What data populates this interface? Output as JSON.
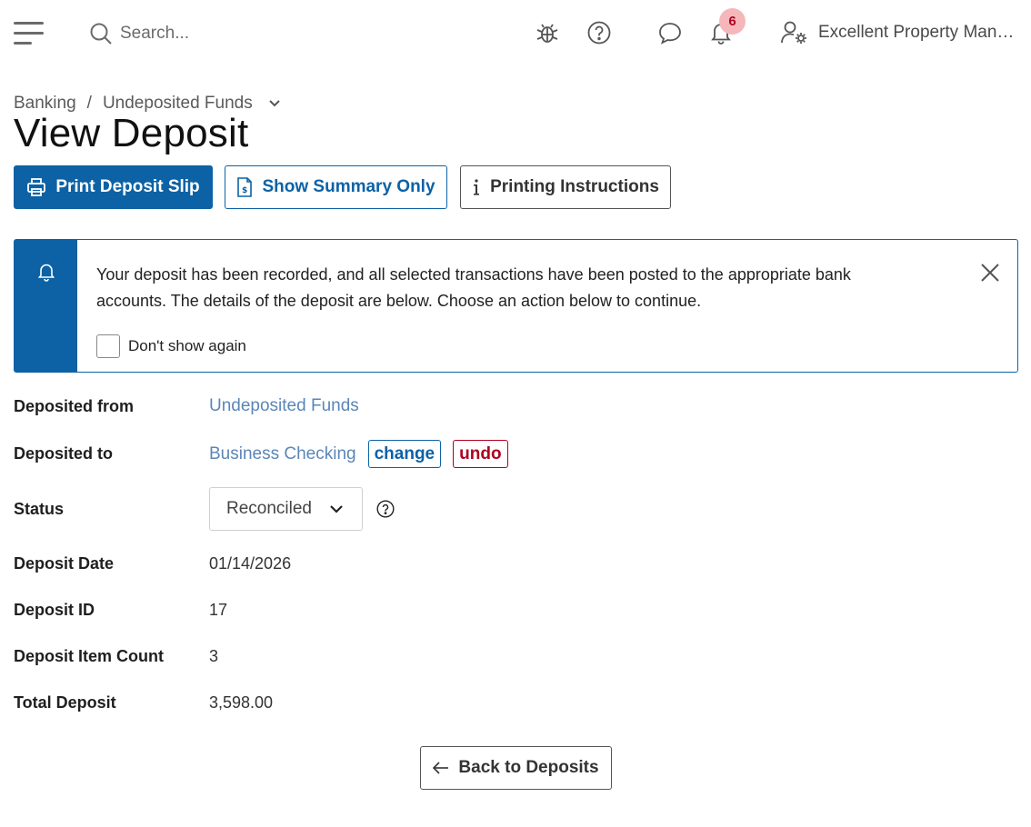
{
  "topbar": {
    "search_placeholder": "Search...",
    "notification_count": "6",
    "account_name": "Excellent Property Mana..."
  },
  "breadcrumb": {
    "items": [
      "Banking",
      "Undeposited Funds"
    ]
  },
  "page": {
    "title": "View Deposit"
  },
  "actions": {
    "print_slip": "Print Deposit Slip",
    "summary_only": "Show Summary Only",
    "printing_instructions": "Printing Instructions"
  },
  "alert": {
    "message": "Your deposit has been recorded, and all selected transactions have been posted to the appropriate bank accounts. The details of the deposit are below. Choose an action below to continue.",
    "dont_show_label": "Don't show again"
  },
  "details": {
    "deposited_from": {
      "label": "Deposited from",
      "value": "Undeposited Funds"
    },
    "deposited_to": {
      "label": "Deposited to",
      "value": "Business Checking",
      "change": "change",
      "undo": "undo"
    },
    "status": {
      "label": "Status",
      "value": "Reconciled"
    },
    "deposit_date": {
      "label": "Deposit Date",
      "value": "01/14/2026"
    },
    "deposit_id": {
      "label": "Deposit ID",
      "value": "17"
    },
    "item_count": {
      "label": "Deposit Item Count",
      "value": "3"
    },
    "total": {
      "label": "Total Deposit",
      "value": "3,598.00"
    }
  },
  "footer": {
    "back_label": "Back to Deposits"
  },
  "colors": {
    "primary": "#0c62a5",
    "danger": "#b00020",
    "link": "#5b86b8",
    "badge_bg": "#f6b7bb"
  }
}
